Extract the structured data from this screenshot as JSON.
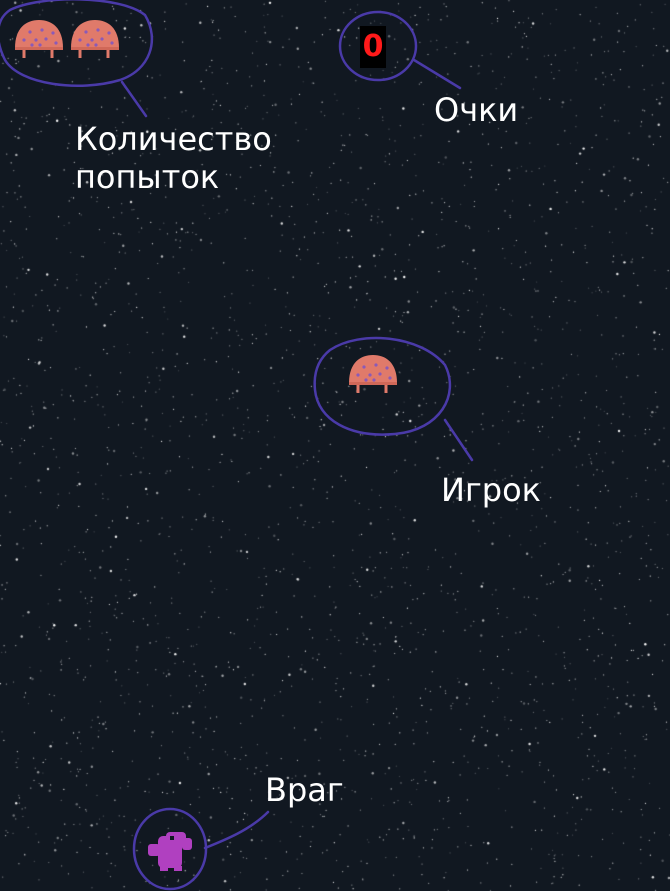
{
  "hud": {
    "score": "0",
    "lives_count": 2
  },
  "labels": {
    "lives": "Количество попыток",
    "score": "Очки",
    "player": "Игрок",
    "enemy": "Враг"
  },
  "sprites": {
    "life": "mushroom-ship-icon",
    "player": "mushroom-ship-icon",
    "enemy": "alien-enemy-icon"
  },
  "colors": {
    "background": "#111821",
    "annotation": "#4a3aa8",
    "ship": "#e07a6a",
    "ship_dots": "#8a5ab8",
    "enemy": "#b040c0",
    "score": "#ff1a1a"
  }
}
